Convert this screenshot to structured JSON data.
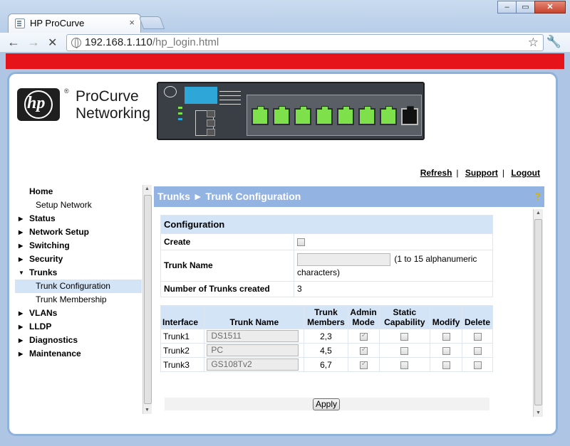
{
  "browser": {
    "tab_title": "HP ProCurve",
    "tab_close": "×",
    "url_host": "192.168.1.110",
    "url_path": "/hp_login.html",
    "back": "←",
    "forward": "→",
    "stop": "✕",
    "bookmark": "☆",
    "wrench": "🔧",
    "win_minimize": "–",
    "win_maximize": "▭",
    "win_close": "✕"
  },
  "brand": {
    "logo": "hp",
    "reg": "®",
    "line1": "ProCurve",
    "line2": "Networking"
  },
  "top_links": {
    "refresh": "Refresh",
    "support": "Support",
    "logout": "Logout",
    "sep": "|"
  },
  "nav": {
    "items": [
      {
        "label": "Home",
        "arrow": ""
      },
      {
        "label": "Setup Network",
        "arrow": ""
      },
      {
        "label": "Status",
        "arrow": "▶"
      },
      {
        "label": "Network Setup",
        "arrow": "▶"
      },
      {
        "label": "Switching",
        "arrow": "▶"
      },
      {
        "label": "Security",
        "arrow": "▶"
      },
      {
        "label": "Trunks",
        "arrow": "▼"
      },
      {
        "label": "Trunk Configuration",
        "arrow": ""
      },
      {
        "label": "Trunk Membership",
        "arrow": ""
      },
      {
        "label": "VLANs",
        "arrow": "▶"
      },
      {
        "label": "LLDP",
        "arrow": "▶"
      },
      {
        "label": "Diagnostics",
        "arrow": "▶"
      },
      {
        "label": "Maintenance",
        "arrow": "▶"
      }
    ]
  },
  "main": {
    "breadcrumb": "Trunks ► Trunk Configuration",
    "help": "?",
    "config": {
      "heading": "Configuration",
      "create_label": "Create",
      "trunk_name_label": "Trunk Name",
      "trunk_name_hint": "(1 to 15 alphanumeric characters)",
      "num_trunks_label": "Number of Trunks created",
      "num_trunks_value": "3"
    },
    "table": {
      "headers": [
        "Interface",
        "Trunk Name",
        "Trunk Members",
        "Admin Mode",
        "Static Capability",
        "Modify",
        "Delete"
      ],
      "rows": [
        {
          "interface": "Trunk1",
          "name": "DS1511",
          "members": "2,3"
        },
        {
          "interface": "Trunk2",
          "name": "PC",
          "members": "4,5"
        },
        {
          "interface": "Trunk3",
          "name": "GS108Tv2",
          "members": "6,7"
        }
      ]
    },
    "apply_label": "Apply"
  },
  "scroll": {
    "up": "▲",
    "down": "▼"
  }
}
